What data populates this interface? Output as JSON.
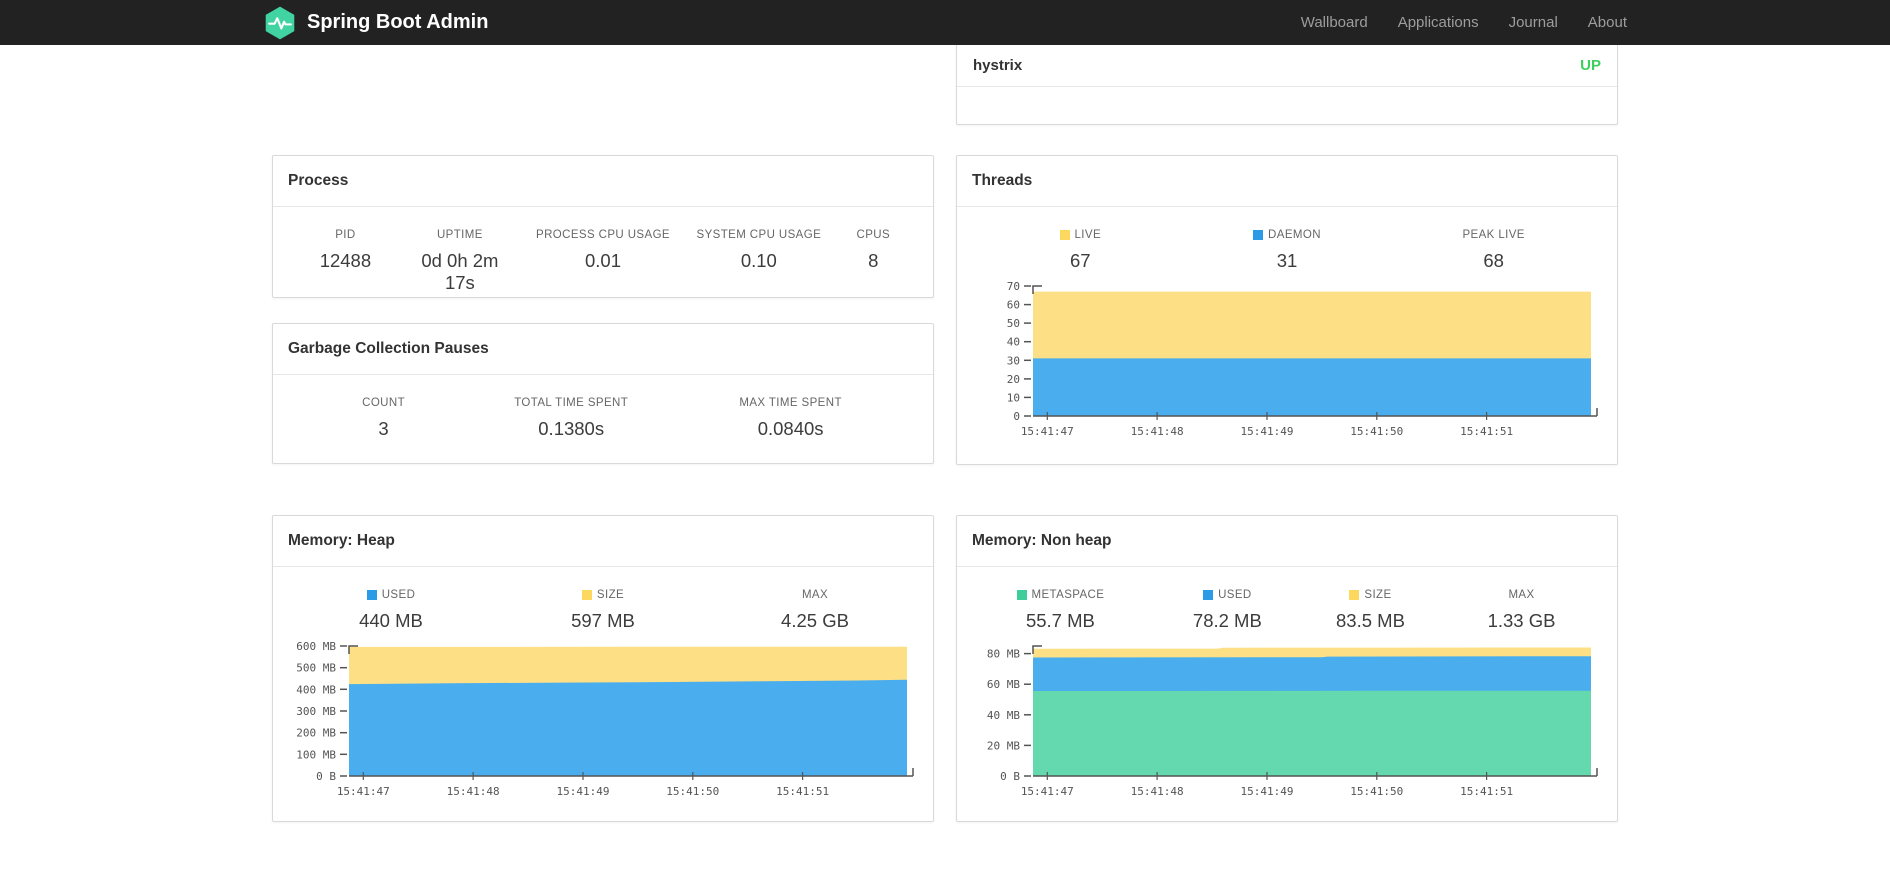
{
  "navbar": {
    "brand": "Spring Boot Admin",
    "logo_color": "#41d3a2",
    "links": [
      {
        "label": "Wallboard"
      },
      {
        "label": "Applications"
      },
      {
        "label": "Journal"
      },
      {
        "label": "About"
      }
    ]
  },
  "application_status": {
    "name": "hystrix",
    "status": "UP",
    "status_color": "#3dd05e"
  },
  "cards": {
    "process": {
      "title": "Process",
      "metrics": [
        {
          "label": "PID",
          "value": "12488"
        },
        {
          "label": "UPTIME",
          "value": "0d 0h 2m 17s"
        },
        {
          "label": "PROCESS CPU USAGE",
          "value": "0.01"
        },
        {
          "label": "SYSTEM CPU USAGE",
          "value": "0.10"
        },
        {
          "label": "CPUS",
          "value": "8"
        }
      ]
    },
    "gc": {
      "title": "Garbage Collection Pauses",
      "metrics": [
        {
          "label": "COUNT",
          "value": "3"
        },
        {
          "label": "TOTAL TIME SPENT",
          "value": "0.1380s"
        },
        {
          "label": "MAX TIME SPENT",
          "value": "0.0840s"
        }
      ]
    },
    "threads": {
      "title": "Threads",
      "metrics": [
        {
          "label": "LIVE",
          "value": "67",
          "swatch": "#fcd95e"
        },
        {
          "label": "DAEMON",
          "value": "31",
          "swatch": "#2b9be8"
        },
        {
          "label": "PEAK LIVE",
          "value": "68"
        }
      ]
    },
    "heap": {
      "title": "Memory: Heap",
      "metrics": [
        {
          "label": "USED",
          "value": "440 MB",
          "swatch": "#2b9be8"
        },
        {
          "label": "SIZE",
          "value": "597 MB",
          "swatch": "#fcd95e"
        },
        {
          "label": "MAX",
          "value": "4.25 GB"
        }
      ]
    },
    "nonheap": {
      "title": "Memory: Non heap",
      "metrics": [
        {
          "label": "METASPACE",
          "value": "55.7 MB",
          "swatch": "#3ecd9b"
        },
        {
          "label": "USED",
          "value": "78.2 MB",
          "swatch": "#2b9be8"
        },
        {
          "label": "SIZE",
          "value": "83.5 MB",
          "swatch": "#fcd95e"
        },
        {
          "label": "MAX",
          "value": "1.33 GB"
        }
      ]
    }
  },
  "chart_data": [
    {
      "id": "threads",
      "type": "area",
      "stacked": true,
      "title": "Threads",
      "x_unit": "seconds since 15:41:47",
      "xlim": [
        -0.13,
        4.95
      ],
      "ylim": [
        0,
        70
      ],
      "xticks": [
        {
          "t": 0,
          "label": "15:41:47"
        },
        {
          "t": 1,
          "label": "15:41:48"
        },
        {
          "t": 2,
          "label": "15:41:49"
        },
        {
          "t": 3,
          "label": "15:41:50"
        },
        {
          "t": 4,
          "label": "15:41:51"
        }
      ],
      "yticks": [
        {
          "v": 0,
          "label": "0"
        },
        {
          "v": 10,
          "label": "10"
        },
        {
          "v": 20,
          "label": "20"
        },
        {
          "v": 30,
          "label": "30"
        },
        {
          "v": 40,
          "label": "40"
        },
        {
          "v": 50,
          "label": "50"
        },
        {
          "v": 60,
          "label": "60"
        },
        {
          "v": 70,
          "label": "70"
        }
      ],
      "layers": [
        {
          "name": "LIVE (total)",
          "color": "#fde086",
          "points": [
            [
              -0.13,
              67
            ],
            [
              4.95,
              67
            ]
          ]
        },
        {
          "name": "DAEMON",
          "color": "#4aaeee",
          "points": [
            [
              -0.13,
              31
            ],
            [
              4.95,
              31
            ]
          ]
        }
      ]
    },
    {
      "id": "heap",
      "type": "area",
      "stacked": true,
      "title": "Memory: Heap",
      "x_unit": "seconds since 15:41:47",
      "xlim": [
        -0.13,
        4.95
      ],
      "ylim": [
        0,
        600
      ],
      "xticks": [
        {
          "t": 0,
          "label": "15:41:47"
        },
        {
          "t": 1,
          "label": "15:41:48"
        },
        {
          "t": 2,
          "label": "15:41:49"
        },
        {
          "t": 3,
          "label": "15:41:50"
        },
        {
          "t": 4,
          "label": "15:41:51"
        }
      ],
      "yticks": [
        {
          "v": 0,
          "label": "0 B"
        },
        {
          "v": 100,
          "label": "100 MB"
        },
        {
          "v": 200,
          "label": "200 MB"
        },
        {
          "v": 300,
          "label": "300 MB"
        },
        {
          "v": 400,
          "label": "400 MB"
        },
        {
          "v": 500,
          "label": "500 MB"
        },
        {
          "v": 600,
          "label": "600 MB"
        }
      ],
      "layers": [
        {
          "name": "SIZE",
          "color": "#fde086",
          "points": [
            [
              -0.13,
              596
            ],
            [
              4.95,
              597
            ]
          ]
        },
        {
          "name": "USED",
          "color": "#4aaeee",
          "points": [
            [
              -0.13,
              424
            ],
            [
              0.8,
              428
            ],
            [
              1.8,
              431
            ],
            [
              2.8,
              434
            ],
            [
              3.8,
              438
            ],
            [
              4.5,
              441
            ],
            [
              4.95,
              444
            ]
          ]
        }
      ]
    },
    {
      "id": "nonheap",
      "type": "area",
      "stacked": true,
      "title": "Memory: Non heap",
      "x_unit": "seconds since 15:41:47",
      "xlim": [
        -0.13,
        4.95
      ],
      "ylim": [
        0,
        85
      ],
      "xticks": [
        {
          "t": 0,
          "label": "15:41:47"
        },
        {
          "t": 1,
          "label": "15:41:48"
        },
        {
          "t": 2,
          "label": "15:41:49"
        },
        {
          "t": 3,
          "label": "15:41:50"
        },
        {
          "t": 4,
          "label": "15:41:51"
        }
      ],
      "yticks": [
        {
          "v": 0,
          "label": "0 B"
        },
        {
          "v": 20,
          "label": "20 MB"
        },
        {
          "v": 40,
          "label": "40 MB"
        },
        {
          "v": 60,
          "label": "60 MB"
        },
        {
          "v": 80,
          "label": "80 MB"
        }
      ],
      "layers": [
        {
          "name": "SIZE",
          "color": "#fde086",
          "points": [
            [
              -0.13,
              83.2
            ],
            [
              1.55,
              83.3
            ],
            [
              1.6,
              83.9
            ],
            [
              4.95,
              84.0
            ]
          ]
        },
        {
          "name": "USED",
          "color": "#4aaeee",
          "points": [
            [
              -0.13,
              77.5
            ],
            [
              2.5,
              77.7
            ],
            [
              2.55,
              78.1
            ],
            [
              4.95,
              78.3
            ]
          ]
        },
        {
          "name": "METASPACE",
          "color": "#64d8ae",
          "points": [
            [
              -0.13,
              55.6
            ],
            [
              4.95,
              55.8
            ]
          ]
        }
      ]
    }
  ]
}
